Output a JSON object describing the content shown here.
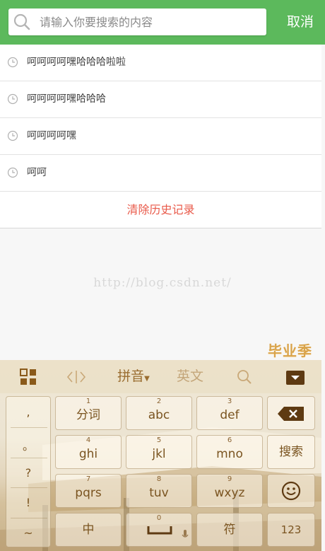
{
  "search": {
    "placeholder": "请输入你要搜索的内容",
    "cancel_label": "取消"
  },
  "history": {
    "items": [
      {
        "text": "呵呵呵呵嘿哈哈哈啦啦"
      },
      {
        "text": "呵呵呵呵嘿哈哈哈"
      },
      {
        "text": "呵呵呵呵嘿"
      },
      {
        "text": "呵呵"
      }
    ],
    "clear_label": "清除历史记录"
  },
  "watermark": "http://blog.csdn.net/",
  "keyboard": {
    "badge": "毕业季",
    "toolbar": {
      "mode_label": "拼音",
      "lang_label": "英文"
    },
    "punctuation": [
      ",",
      "。",
      "?",
      "!",
      "~"
    ],
    "keys": {
      "k1": {
        "num": "1",
        "label": "分词"
      },
      "k2": {
        "num": "2",
        "label": "abc"
      },
      "k3": {
        "num": "3",
        "label": "def"
      },
      "k4": {
        "num": "4",
        "label": "ghi"
      },
      "k5": {
        "num": "5",
        "label": "jkl"
      },
      "k6": {
        "num": "6",
        "label": "mno"
      },
      "k7": {
        "num": "7",
        "label": "pqrs"
      },
      "k8": {
        "num": "8",
        "label": "tuv"
      },
      "k9": {
        "num": "9",
        "label": "wxyz"
      },
      "k0": {
        "num": "0"
      },
      "search": {
        "label": "搜索"
      },
      "zhong": {
        "label": "中"
      },
      "symbol": {
        "label": "符"
      },
      "numbers": {
        "label": "123"
      }
    },
    "icons": [
      "grid-icon",
      "cursor-icon",
      "search-icon",
      "collapse-keyboard-icon",
      "backspace-icon",
      "emoji-icon",
      "space-icon",
      "microphone-icon"
    ],
    "colors": {
      "accent": "#5cb95c",
      "key_text": "#7a5420",
      "clear_text": "#e95a4a"
    }
  }
}
